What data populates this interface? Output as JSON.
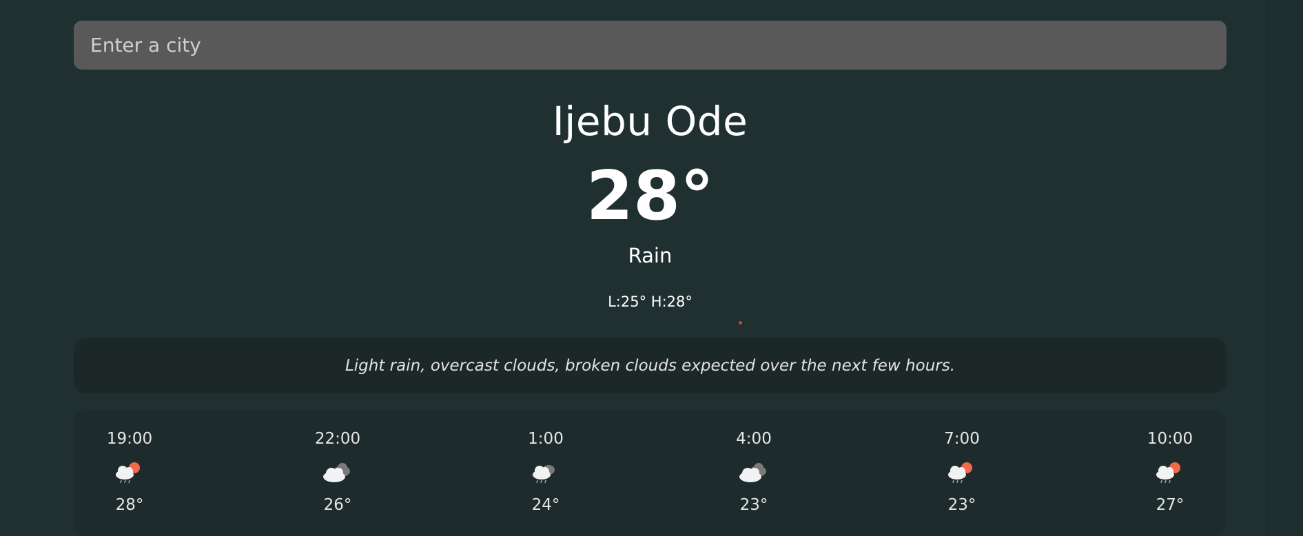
{
  "search": {
    "placeholder": "Enter a city"
  },
  "current": {
    "city": "Ijebu Ode",
    "temperature": "28°",
    "condition": "Rain",
    "low_high": "L:25° H:28°"
  },
  "summary": "Light rain, overcast clouds, broken clouds expected over the next few hours.",
  "hourly": [
    {
      "time": "19:00",
      "icon": "rain-cloud-sun-icon",
      "temp": "28°"
    },
    {
      "time": "22:00",
      "icon": "overcast-clouds-icon",
      "temp": "26°"
    },
    {
      "time": "1:00",
      "icon": "rain-cloud-icon",
      "temp": "24°"
    },
    {
      "time": "4:00",
      "icon": "overcast-clouds-icon",
      "temp": "23°"
    },
    {
      "time": "7:00",
      "icon": "rain-cloud-sun-icon",
      "temp": "23°"
    },
    {
      "time": "10:00",
      "icon": "rain-cloud-sun-icon",
      "temp": "27°"
    }
  ],
  "colors": {
    "background": "#203031",
    "search_bg": "#595959",
    "summary_bg": "#1c2828",
    "forecast_bg": "#1e2b2c",
    "sun": "#f26a4b",
    "cloud": "#f2f2f2",
    "dark_cloud": "#7a7a7a"
  }
}
